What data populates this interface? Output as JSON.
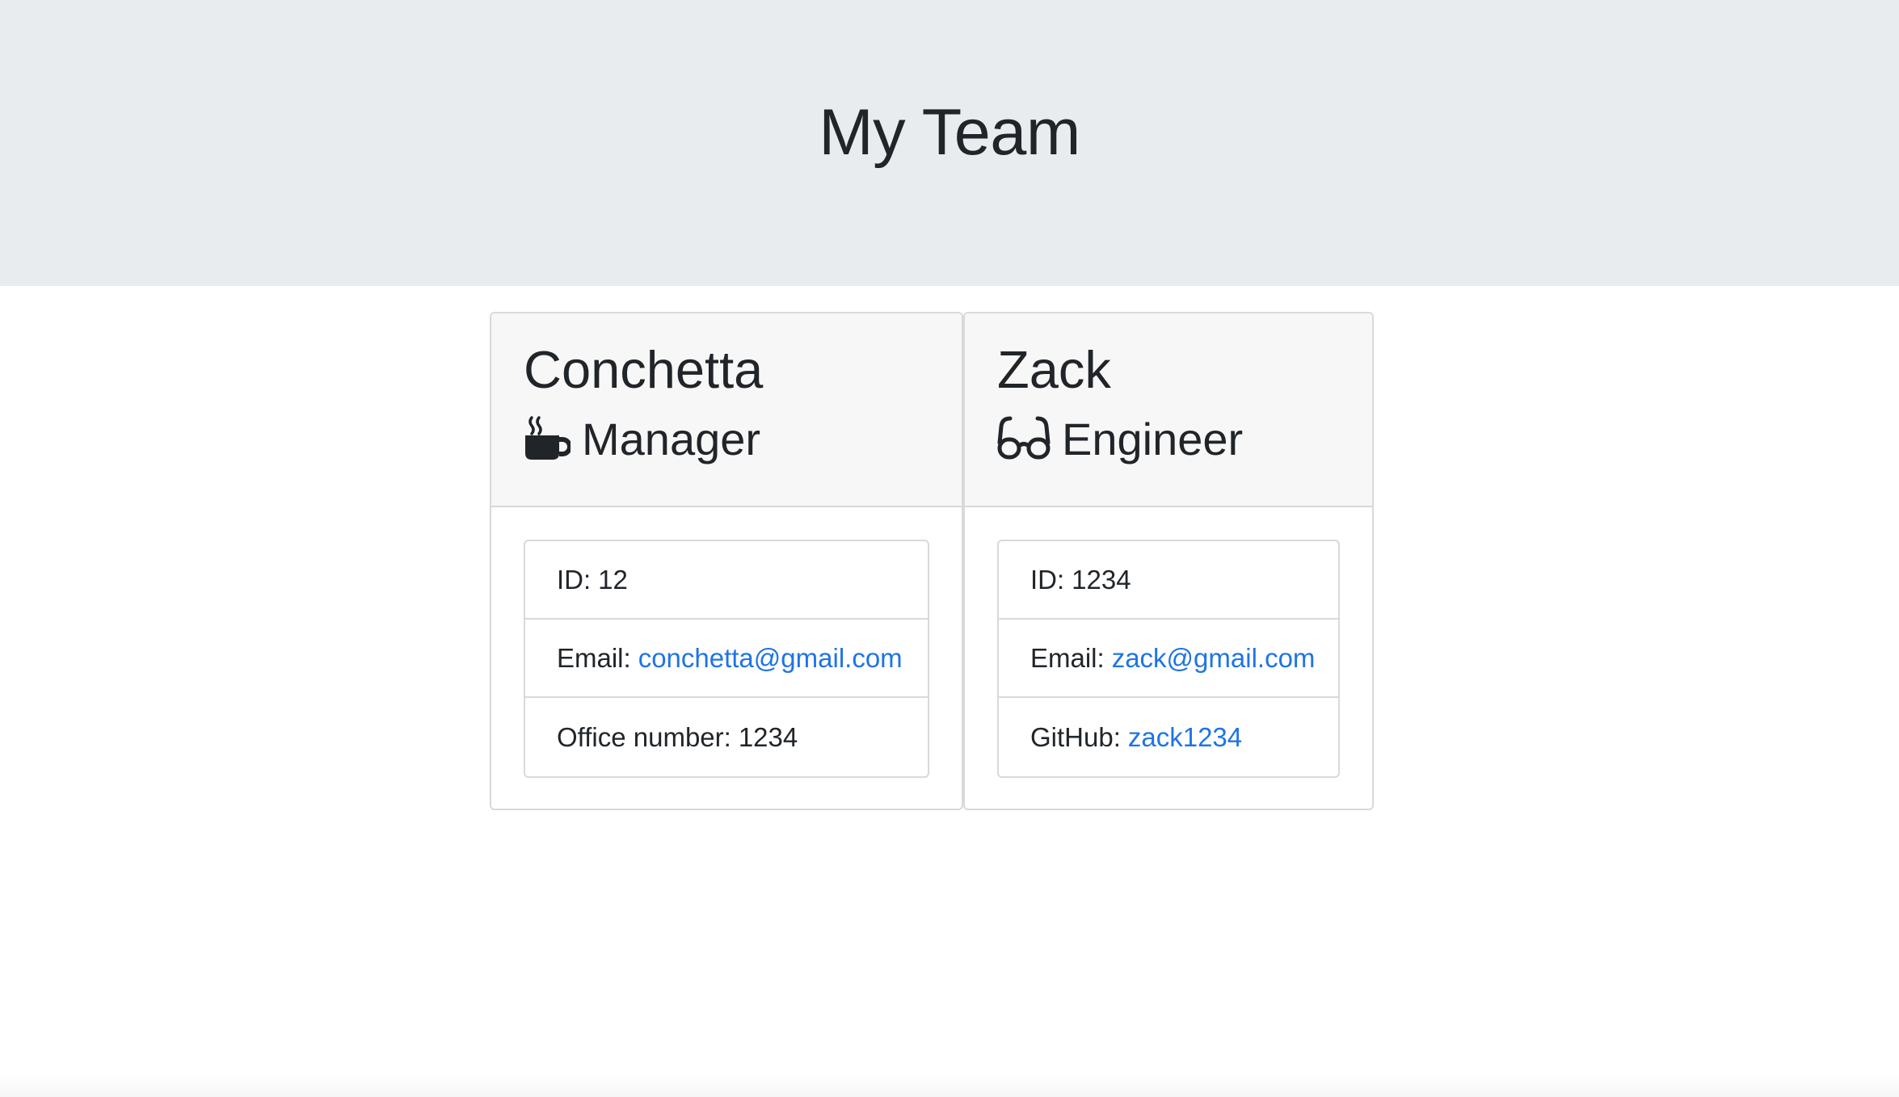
{
  "header": {
    "title": "My Team"
  },
  "cards": [
    {
      "name": "Conchetta",
      "role": "Manager",
      "role_icon": "coffee-mug-icon",
      "items": [
        {
          "label": "ID:",
          "value": "12"
        },
        {
          "label": "Email:",
          "value": "conchetta@gmail.com"
        },
        {
          "label": "Office number:",
          "value": "1234"
        }
      ]
    },
    {
      "name": "Zack",
      "role": "Engineer",
      "role_icon": "glasses-icon",
      "items": [
        {
          "label": "ID:",
          "value": "1234"
        },
        {
          "label": "Email:",
          "value": "zack@gmail.com"
        },
        {
          "label": "GitHub:",
          "value": "zack1234"
        }
      ]
    }
  ],
  "colors": {
    "header_bg": "#e9ecef",
    "link": "#1f74e6",
    "text": "#212529"
  }
}
